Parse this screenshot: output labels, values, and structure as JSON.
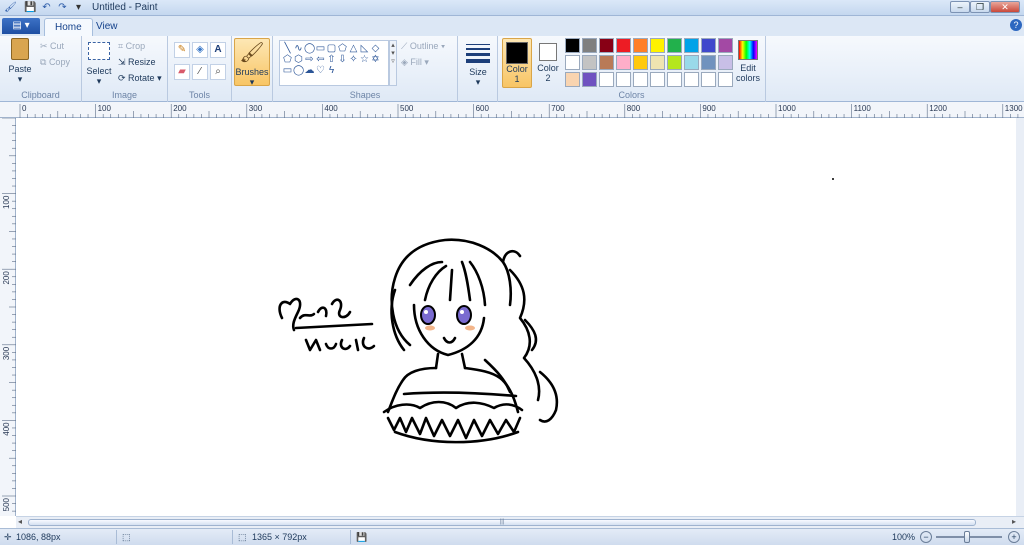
{
  "window": {
    "title": "Untitled - Paint"
  },
  "tabs": [
    {
      "label": "Home"
    },
    {
      "label": "View"
    }
  ],
  "clipboard": {
    "paste": "Paste",
    "cut": "Cut",
    "copy": "Copy",
    "group": "Clipboard"
  },
  "image": {
    "select": "Select",
    "crop": "Crop",
    "resize": "Resize",
    "rotate": "Rotate",
    "group": "Image"
  },
  "tools": {
    "group": "Tools"
  },
  "brushes": {
    "label": "Brushes"
  },
  "shapes": {
    "outline": "Outline",
    "fill": "Fill",
    "group": "Shapes"
  },
  "size": {
    "label": "Size"
  },
  "colors": {
    "color1": "Color\n1",
    "color1_a": "Color",
    "color1_b": "1",
    "color2_a": "Color",
    "color2_b": "2",
    "edit_a": "Edit",
    "edit_b": "colors",
    "group": "Colors",
    "color1_value": "#000000",
    "color2_value": "#ffffff",
    "palette_row1": [
      "#000000",
      "#7f7f7f",
      "#880015",
      "#ed1c24",
      "#ff7f27",
      "#fff200",
      "#22b14c",
      "#00a2e8",
      "#3f48cc",
      "#a349a4"
    ],
    "palette_row2": [
      "#ffffff",
      "#c3c3c3",
      "#b97a57",
      "#ffaec9",
      "#ffc90e",
      "#efe4b0",
      "#b5e61d",
      "#99d9ea",
      "#7092be",
      "#c8bfe7"
    ],
    "palette_row3": [
      "#f9d4b0",
      "#6f52c0",
      "#ffffff",
      "#ffffff",
      "#ffffff",
      "#ffffff",
      "#ffffff",
      "#ffffff",
      "#ffffff",
      "#ffffff"
    ]
  },
  "ruler": {
    "h_labels": [
      "0",
      "100",
      "200",
      "300",
      "400",
      "500",
      "600",
      "700",
      "800",
      "900",
      "1000",
      "1100",
      "1200",
      "1300"
    ],
    "v_labels": [
      "100",
      "200",
      "300",
      "400",
      "500"
    ]
  },
  "canvas": {
    "signature": "Muiacute"
  },
  "status": {
    "cursor": "1086, 88px",
    "size": "1365 × 792px",
    "zoom": "100%"
  }
}
